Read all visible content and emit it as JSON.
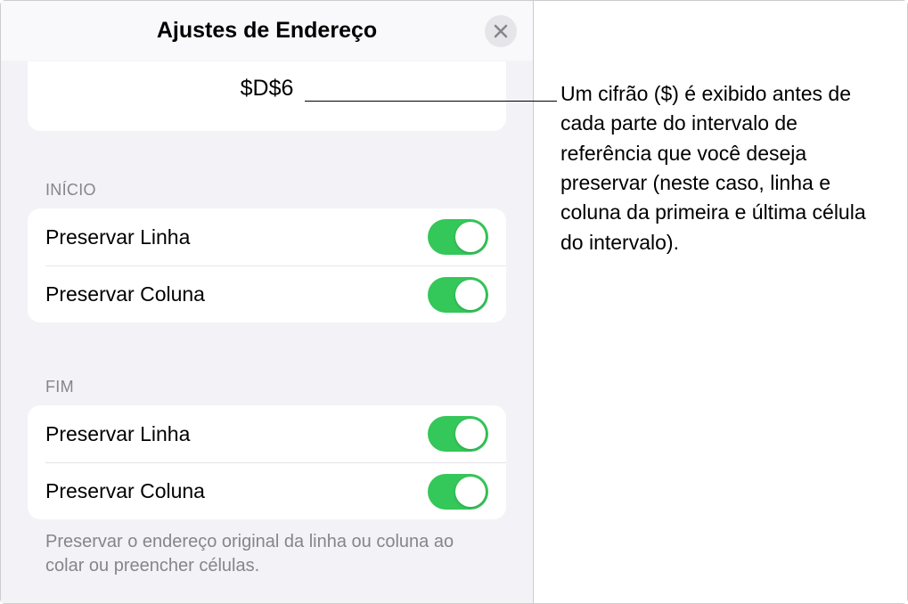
{
  "header": {
    "title": "Ajustes de Endereço"
  },
  "cell_reference": "$D$6",
  "sections": {
    "start": {
      "label": "INÍCIO",
      "rows": [
        {
          "label": "Preservar Linha",
          "on": true
        },
        {
          "label": "Preservar Coluna",
          "on": true
        }
      ]
    },
    "end": {
      "label": "FIM",
      "rows": [
        {
          "label": "Preservar Linha",
          "on": true
        },
        {
          "label": "Preservar Coluna",
          "on": true
        }
      ]
    }
  },
  "footer_text": "Preservar o endereço original da linha ou coluna ao colar ou preencher células.",
  "annotation": "Um cifrão ($) é exibido antes de cada parte do intervalo de referência que você deseja preservar (neste caso, linha e coluna da primeira e última célula do intervalo)."
}
